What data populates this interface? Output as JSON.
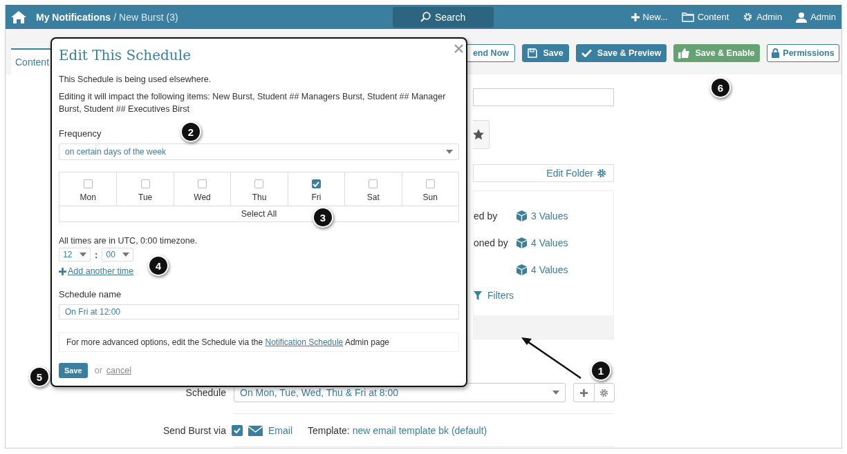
{
  "topbar": {
    "crumbs": [
      "My Notifications",
      "New Burst (3)"
    ],
    "separator": "/",
    "search": "Search",
    "menu": [
      {
        "label": "New...",
        "kind": "plus"
      },
      {
        "label": "Content",
        "kind": "folder"
      },
      {
        "label": "Admin",
        "kind": "gear"
      },
      {
        "label": "Admin",
        "kind": "user"
      }
    ]
  },
  "toolbar": {
    "tabs": [
      {
        "label": "Content",
        "selected": true
      }
    ],
    "buttons": [
      {
        "label": "end Now",
        "kind": "outline"
      },
      {
        "label": "Save",
        "kind": "primary"
      },
      {
        "label": "Save & Preview",
        "kind": "primary"
      },
      {
        "label": "Save & Enable",
        "kind": "success"
      },
      {
        "label": "Permissions",
        "kind": "outline"
      }
    ]
  },
  "form": {
    "edit_folder": "Edit Folder",
    "value_rows": [
      {
        "label": "ed by",
        "value": "3 Values"
      },
      {
        "label": "oned by",
        "value": "4 Values"
      },
      {
        "value": "4 Values"
      }
    ],
    "filters": "Filters",
    "schedule": {
      "label": "Schedule",
      "value": "On Mon, Tue, Wed, Thu & Fri at 8:00"
    },
    "send": {
      "label": "Send Burst via",
      "checked": true,
      "channel": "Email",
      "template_label": "Template:",
      "template": "new email template bk (default)"
    }
  },
  "modal": {
    "title": "Edit This Schedule",
    "notice": "This Schedule is being used elsewhere.",
    "impact": "Editing it will impact the following items: New Burst, Student ## Managers Burst, Student ## Manager Burst, Student ## Executives Birst",
    "frequency_label": "Frequency",
    "frequency": "on certain days of the week",
    "days": [
      {
        "label": "Mon",
        "checked": false
      },
      {
        "label": "Tue",
        "checked": false
      },
      {
        "label": "Wed",
        "checked": false
      },
      {
        "label": "Thu",
        "checked": false
      },
      {
        "label": "Fri",
        "checked": true
      },
      {
        "label": "Sat",
        "checked": false
      },
      {
        "label": "Sun",
        "checked": false
      }
    ],
    "select_all": "Select All",
    "timezone": "All times are in UTC, 0:00 timezone.",
    "hour": "12",
    "time_separator": ":",
    "minute": "00",
    "add_time": "Add another time",
    "name_label": "Schedule name",
    "name_value": "On Fri at 12:00",
    "advanced": {
      "before": "For more advanced options, edit the Schedule via the",
      "link": "Notification Schedule",
      "after": "Admin page"
    },
    "save": "Save",
    "or": "or",
    "cancel": "cancel"
  },
  "annotations": [
    {
      "label": "1"
    },
    {
      "label": "2"
    },
    {
      "label": "3"
    },
    {
      "label": "4"
    },
    {
      "label": "5"
    },
    {
      "label": "6"
    }
  ]
}
